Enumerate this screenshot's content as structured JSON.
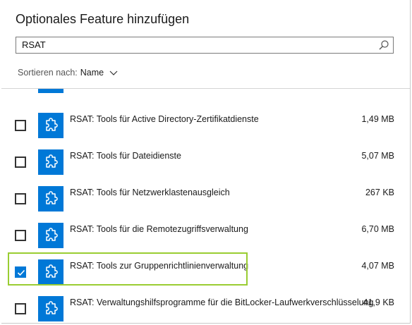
{
  "dialog": {
    "title": "Optionales Feature hinzufügen"
  },
  "search": {
    "value": "RSAT",
    "icon": "search-icon"
  },
  "sort": {
    "label": "Sortieren nach:",
    "value": "Name",
    "icon": "chevron-down-icon"
  },
  "features": [
    {
      "name": "RSAT: Tools für Active Directory-Zertifikatdienste",
      "size": "1,49 MB",
      "checked": false
    },
    {
      "name": "RSAT: Tools für Dateidienste",
      "size": "5,07 MB",
      "checked": false
    },
    {
      "name": "RSAT: Tools für Netzwerklastenausgleich",
      "size": "267 KB",
      "checked": false
    },
    {
      "name": "RSAT: Tools für die Remotezugriffsverwaltung",
      "size": "6,70 MB",
      "checked": false
    },
    {
      "name": "RSAT: Tools zur Gruppenrichtlinienverwaltung",
      "size": "4,07 MB",
      "checked": true
    },
    {
      "name": "RSAT: Verwaltungshilfsprogramme für die BitLocker-Laufwerkverschlüsselung",
      "size": "41,9 KB",
      "checked": false
    }
  ],
  "colors": {
    "accent": "#0078d7",
    "highlight": "#9acd32"
  }
}
